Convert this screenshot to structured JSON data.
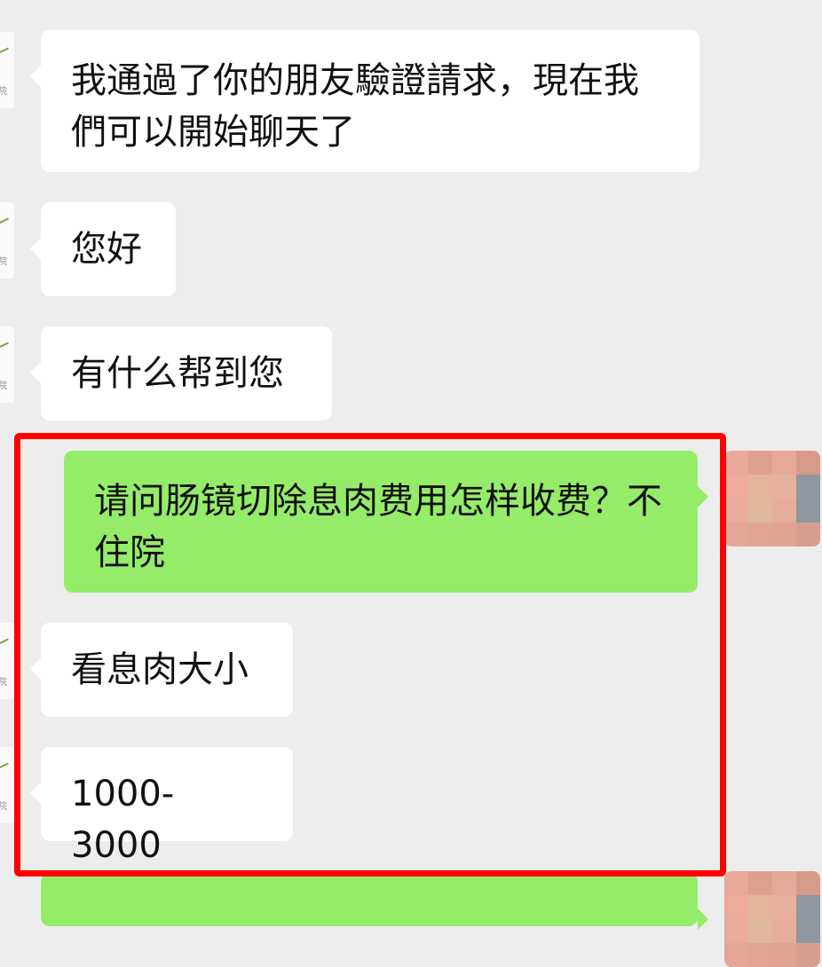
{
  "messages": [
    {
      "side": "in",
      "text": "我通過了你的朋友驗證請求，現在我們可以開始聊天了"
    },
    {
      "side": "in",
      "text": "您好"
    },
    {
      "side": "in",
      "text": "有什么帮到您"
    },
    {
      "side": "out",
      "text": "请问肠镜切除息肉费用怎样收费？不住院"
    },
    {
      "side": "in",
      "text": "看息肉大小"
    },
    {
      "side": "in",
      "text": "1000-3000"
    }
  ],
  "colors": {
    "background": "#ededed",
    "incoming_bubble": "#ffffff",
    "outgoing_bubble": "#95ec69",
    "highlight_border": "#ff0000"
  },
  "icons": {
    "contact_avatar": "hospital-logo-avatar",
    "self_avatar": "pixelated-user-avatar"
  }
}
